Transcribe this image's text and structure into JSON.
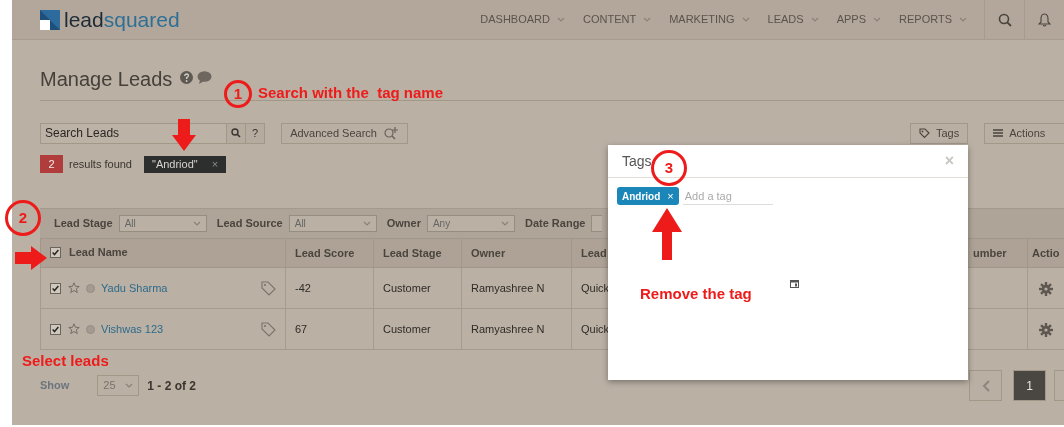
{
  "header": {
    "logo": {
      "part_1": "lead",
      "part_2": "squared"
    },
    "nav": [
      {
        "label": "DASHBOARD"
      },
      {
        "label": "CONTENT"
      },
      {
        "label": "MARKETING"
      },
      {
        "label": "LEADS"
      },
      {
        "label": "APPS"
      },
      {
        "label": "REPORTS"
      }
    ]
  },
  "page_title": "Manage Leads",
  "search": {
    "placeholder": "Search Leads",
    "help": "?"
  },
  "advanced_search": "Advanced Search",
  "tags_button": "Tags",
  "actions_button": "Actions",
  "results": {
    "count": "2",
    "label": "results found",
    "filter_chip": "\"Andriod\"",
    "chip_close": "×"
  },
  "filters": [
    {
      "label": "Lead Stage",
      "value": "All"
    },
    {
      "label": "Lead Source",
      "value": "All"
    },
    {
      "label": "Owner",
      "value": "Any"
    },
    {
      "label": "Date Range"
    }
  ],
  "table": {
    "select_all_checked": true,
    "columns": [
      "Lead Name",
      "Lead Score",
      "Lead Stage",
      "Owner",
      "Lead",
      "umber",
      "Actio"
    ],
    "rows": [
      {
        "checked": true,
        "starred": false,
        "name": "Yadu Sharma",
        "score": "-42",
        "stage": "Customer",
        "owner": "Ramyashree N",
        "column_5": "Quick"
      },
      {
        "checked": true,
        "starred": false,
        "name": "Vishwas 123",
        "score": "67",
        "stage": "Customer",
        "owner": "Ramyashree N",
        "column_5": "Quick"
      }
    ]
  },
  "pager": {
    "show_label": "Show",
    "page_size": "25",
    "range": "1 - 2 of 2",
    "pages": [
      {
        "label": "1",
        "selected": true
      }
    ]
  },
  "modal": {
    "title": "Tags",
    "close": "×",
    "tags": [
      {
        "label": "Andriod",
        "remove": "×"
      }
    ],
    "input_placeholder": "Add a tag"
  },
  "annotations": [
    {
      "kind": "circle",
      "text": "1"
    },
    {
      "kind": "note",
      "text": "Search with the  tag name"
    },
    {
      "kind": "arrow"
    },
    {
      "kind": "circle",
      "text": "2"
    },
    {
      "kind": "arrow"
    },
    {
      "kind": "note",
      "text": "Select leads"
    },
    {
      "kind": "circle",
      "text": "3"
    },
    {
      "kind": "arrow"
    },
    {
      "kind": "note",
      "text": "Remove the tag"
    }
  ]
}
